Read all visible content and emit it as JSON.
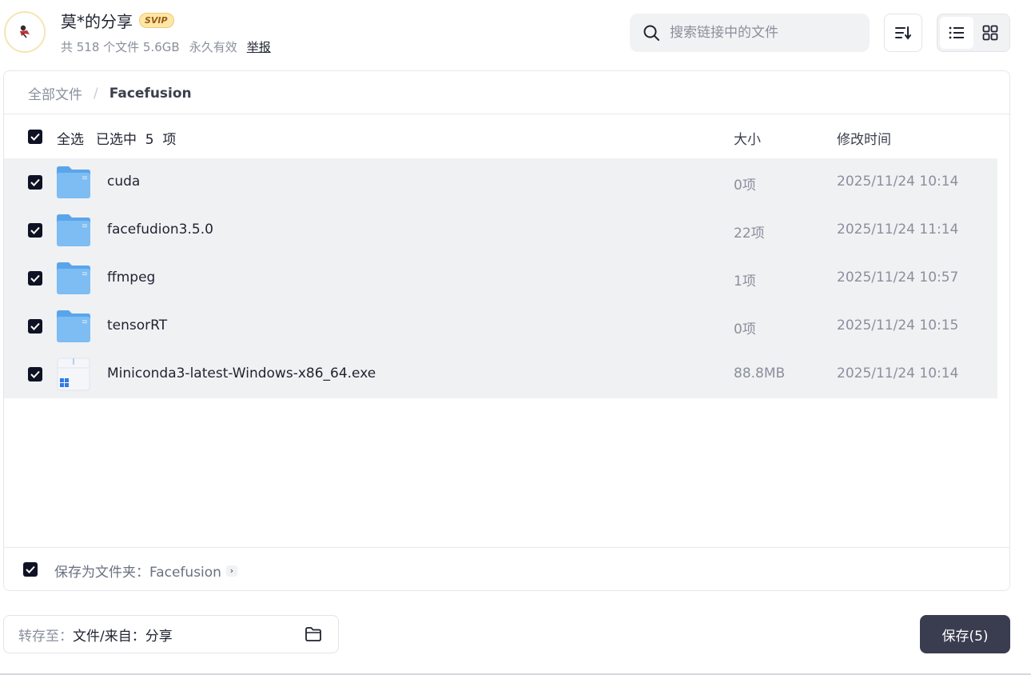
{
  "header": {
    "title": "莫*的分享",
    "badge": "SVIP",
    "meta": {
      "file_count": "共 518 个文件 5.6GB",
      "validity": "永久有效",
      "report": "举报"
    }
  },
  "search": {
    "placeholder": "搜索链接中的文件"
  },
  "breadcrumb": {
    "root": "全部文件",
    "separator": "/",
    "current": "Facefusion"
  },
  "list_header": {
    "select_all": "全选",
    "selected_count": "已选中  5  项",
    "col_size": "大小",
    "col_time": "修改时间"
  },
  "files": [
    {
      "name": "cuda",
      "size": "0项",
      "time": "2025/11/24 10:14",
      "type": "folder"
    },
    {
      "name": "facefudion3.5.0",
      "size": "22项",
      "time": "2025/11/24 11:14",
      "type": "folder"
    },
    {
      "name": "ffmpeg",
      "size": "1项",
      "time": "2025/11/24 10:57",
      "type": "folder"
    },
    {
      "name": "tensorRT",
      "size": "0项",
      "time": "2025/11/24 10:15",
      "type": "folder"
    },
    {
      "name": "Miniconda3-latest-Windows-x86_64.exe",
      "size": "88.8MB",
      "time": "2025/11/24 10:14",
      "type": "exe"
    }
  ],
  "save_as": {
    "label": "保存为文件夹：Facefusion"
  },
  "footer": {
    "target_label": "转存至：",
    "target_value": "文件/来自：分享",
    "save_button": "保存(5)"
  },
  "colors": {
    "accent_dark": "#3a3d4f",
    "checkbox": "#0e1224",
    "row_bg": "#f0f1f3"
  }
}
